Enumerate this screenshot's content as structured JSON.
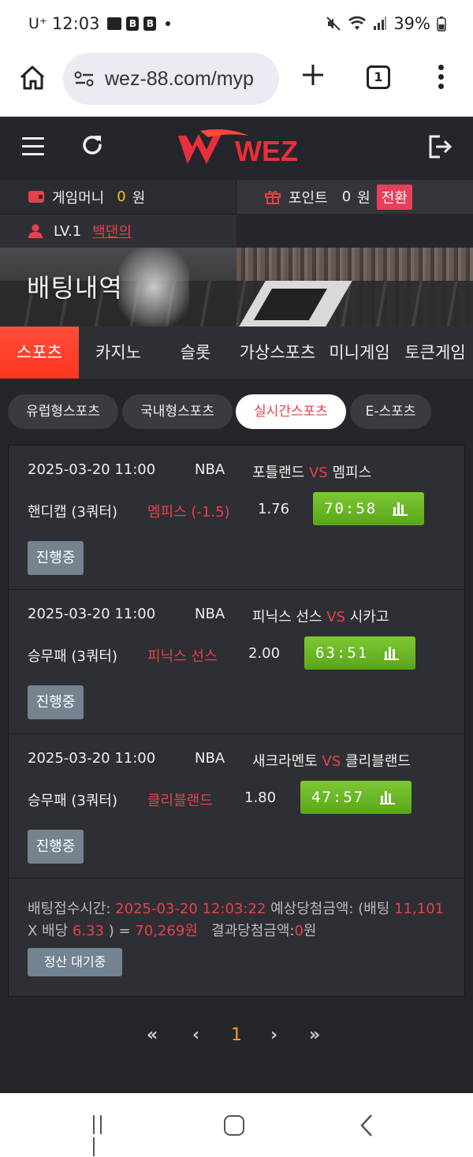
{
  "status_bar": {
    "carrier": "U⁺",
    "time": "12:03",
    "battery": "39%",
    "icons": [
      "gallery-icon",
      "b-app-icon",
      "b-app-icon",
      "dot-icon",
      "mute-icon",
      "wifi-icon",
      "signal-icon",
      "battery-icon"
    ]
  },
  "browser": {
    "url": "wez-88.com/myp",
    "tab_count": "1",
    "icons": [
      "home-icon",
      "site-settings-icon",
      "plus-icon",
      "tabs-icon",
      "more-vert-icon"
    ]
  },
  "header": {
    "logo_text": "WEZ",
    "icons": [
      "menu-icon",
      "refresh-icon",
      "logout-icon"
    ]
  },
  "user": {
    "game_money_label": "게임머니",
    "game_money_value": "0",
    "game_money_unit": "원",
    "point_label": "포인트",
    "point_value": "0",
    "point_unit": "원",
    "convert_label": "전환",
    "level": "LV.1",
    "name": "백댄의"
  },
  "banner": {
    "title": "배팅내역"
  },
  "category_tabs": [
    {
      "label": "스포츠",
      "active": true
    },
    {
      "label": "카지노",
      "active": false
    },
    {
      "label": "슬롯",
      "active": false
    },
    {
      "label": "가상스포츠",
      "active": false
    },
    {
      "label": "미니게임",
      "active": false
    },
    {
      "label": "토큰게임",
      "active": false
    }
  ],
  "sub_tabs": [
    {
      "label": "유럽형스포츠",
      "active": false
    },
    {
      "label": "국내형스포츠",
      "active": false
    },
    {
      "label": "실시간스포츠",
      "active": true
    },
    {
      "label": "E-스포츠",
      "active": false
    }
  ],
  "bets": [
    {
      "datetime": "2025-03-20 11:00",
      "league": "NBA",
      "home": "포틀랜드",
      "vs": "VS",
      "away": "멤피스",
      "market": "핸디캡 (3쿼터)",
      "pick": "멤피스 (-1.5)",
      "odds": "1.76",
      "score": "70:58",
      "status": "진행중"
    },
    {
      "datetime": "2025-03-20 11:00",
      "league": "NBA",
      "home": "피닉스 선스",
      "vs": "VS",
      "away": "시카고",
      "market": "승무패 (3쿼터)",
      "pick": "피닉스 선스",
      "odds": "2.00",
      "score": "63:51",
      "status": "진행중"
    },
    {
      "datetime": "2025-03-20 11:00",
      "league": "NBA",
      "home": "새크라멘토",
      "vs": "VS",
      "away": "클리블랜드",
      "market": "승무패 (3쿼터)",
      "pick": "클리블랜드",
      "odds": "1.80",
      "score": "47:57",
      "status": "진행중"
    }
  ],
  "summary": {
    "received_label": "배팅접수시간:",
    "received_time": "2025-03-20 12:03:22",
    "expected_label": "예상당첨금액: (배팅",
    "stake": "11,101",
    "x_label": "X 배당",
    "total_odds": "6.33",
    "eq": ") =",
    "expected_amount": "70,269원",
    "result_label": "결과당첨금액:",
    "result_value": "0",
    "result_unit": "원",
    "settle_label": "정산 대기중"
  },
  "pagination": {
    "first": "«",
    "prev": "‹",
    "current": "1",
    "next": "›",
    "last": "»"
  },
  "colors": {
    "accent_red": "#e8404a",
    "active_tab": "#ff3520",
    "score_green": "#6bb826",
    "badge_gray": "#738390",
    "page_current": "#f4a020"
  }
}
